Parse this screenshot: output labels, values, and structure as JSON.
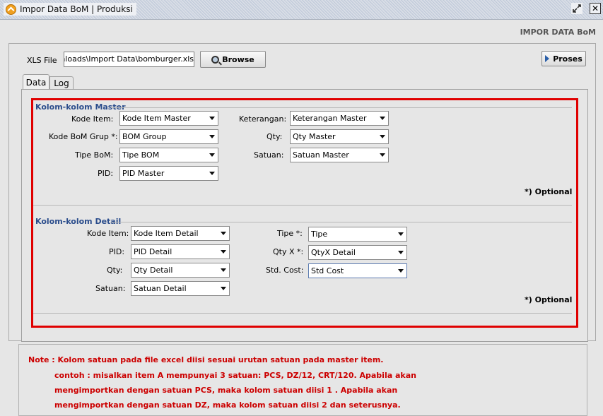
{
  "window": {
    "title": "Impor Data BoM | Produksi"
  },
  "header": {
    "label": "IMPOR DATA BoM"
  },
  "file": {
    "label": "XLS File",
    "value": ")ownloads\\Import Data\\bomburger.xls",
    "browse_label": "Browse",
    "proses_label": "Proses"
  },
  "tabs": [
    {
      "label": "Data"
    },
    {
      "label": "Log"
    }
  ],
  "master": {
    "title": "Kolom-kolom Master",
    "kode_item": {
      "label": "Kode Item:",
      "value": "Kode Item Master"
    },
    "kode_bom_grup": {
      "label": "Kode BoM Grup *:",
      "value": "BOM Group"
    },
    "tipe_bom": {
      "label": "Tipe BoM:",
      "value": "Tipe BOM"
    },
    "pid": {
      "label": "PID:",
      "value": "PID Master"
    },
    "keterangan": {
      "label": "Keterangan:",
      "value": "Keterangan Master"
    },
    "qty": {
      "label": "Qty:",
      "value": "Qty Master"
    },
    "satuan": {
      "label": "Satuan:",
      "value": "Satuan Master"
    },
    "optional": "*) Optional"
  },
  "detail": {
    "title": "Kolom-kolom Detail",
    "kode_item": {
      "label": "Kode Item:",
      "value": "Kode Item Detail"
    },
    "pid": {
      "label": "PID:",
      "value": "PID Detail"
    },
    "qty": {
      "label": "Qty:",
      "value": "Qty Detail"
    },
    "satuan": {
      "label": "Satuan:",
      "value": "Satuan Detail"
    },
    "tipe": {
      "label": "Tipe *:",
      "value": "Tipe"
    },
    "qty_x": {
      "label": "Qty X *:",
      "value": "QtyX Detail"
    },
    "std_cost": {
      "label": "Std. Cost:",
      "value": "Std Cost"
    },
    "optional": "*) Optional"
  },
  "note": {
    "line1": "Note :  Kolom satuan pada file excel diisi sesuai urutan satuan pada master item.",
    "line2": "contoh : misalkan item A mempunyai 3 satuan: PCS, DZ/12, CRT/120. Apabila akan",
    "line3": "mengimportkan dengan satuan PCS,  maka kolom satuan diisi 1 . Apabila akan",
    "line4": "mengimportkan dengan satuan DZ,  maka kolom satuan diisi 2 dan seterusnya."
  }
}
